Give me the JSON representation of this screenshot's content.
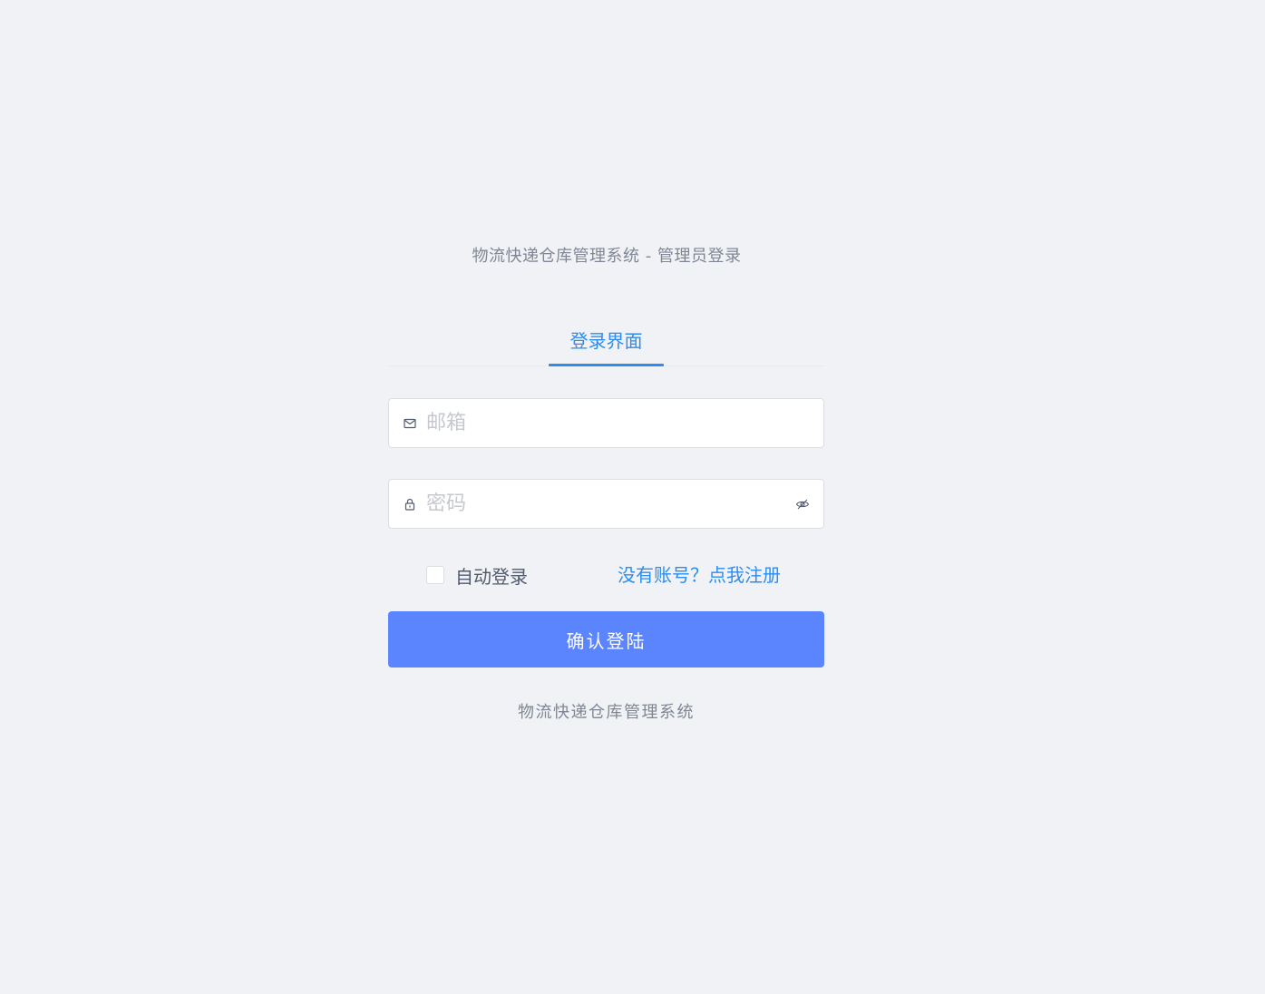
{
  "header": {
    "subtitle": "物流快递仓库管理系统 - 管理员登录"
  },
  "tabs": [
    {
      "label": "登录界面",
      "active": true
    }
  ],
  "form": {
    "email": {
      "placeholder": "邮箱",
      "value": "",
      "icon": "mail-icon"
    },
    "password": {
      "placeholder": "密码",
      "value": "",
      "icon": "lock-icon",
      "toggle_icon": "eye-off-icon"
    },
    "auto_login": {
      "label": "自动登录",
      "checked": false
    },
    "register_link": "没有账号？点我注册",
    "submit_label": "确认登陆"
  },
  "footer": {
    "text": "物流快递仓库管理系统"
  },
  "colors": {
    "background": "#f0f2f5",
    "primary": "#2d8cf0",
    "button": "#5b85ff",
    "muted_text": "#808695",
    "border": "#dcdee2"
  }
}
